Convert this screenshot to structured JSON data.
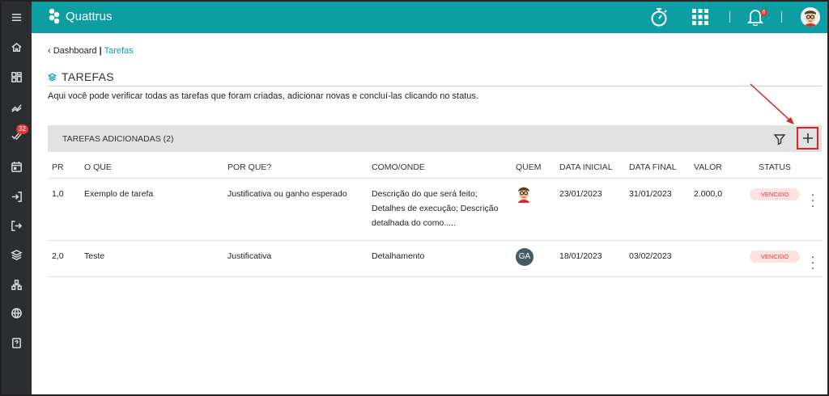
{
  "app": {
    "name": "Quattrus"
  },
  "colors": {
    "topbar": "#0d9ea3",
    "sidebar": "#2b2d31",
    "status_bg": "#fde2e2",
    "status_text": "#e53935",
    "highlight": "#e02020"
  },
  "sidebar": {
    "items": [
      {
        "icon": "menu-icon"
      },
      {
        "icon": "home-icon"
      },
      {
        "icon": "dashboard-icon"
      },
      {
        "icon": "chart-line-icon"
      },
      {
        "icon": "tasks-check-icon",
        "badge": "32"
      },
      {
        "icon": "calendar-icon"
      },
      {
        "icon": "login-icon"
      },
      {
        "icon": "logout-icon"
      },
      {
        "icon": "layers-icon"
      },
      {
        "icon": "sitemap-icon"
      },
      {
        "icon": "globe-icon"
      },
      {
        "icon": "help-icon"
      }
    ]
  },
  "topbar": {
    "bell_badge": "6"
  },
  "breadcrumb": {
    "parent": "Dashboard",
    "separator": "|",
    "current": "Tarefas"
  },
  "page": {
    "title": "TAREFAS",
    "description": "Aqui você pode verificar todas as tarefas que foram criadas, adicionar novas e concluí-las clicando no status."
  },
  "panel": {
    "title": "TAREFAS ADICIONADAS (2)"
  },
  "table": {
    "columns": [
      "PR",
      "O QUE",
      "POR QUE?",
      "COMO/ONDE",
      "QUEM",
      "DATA INICIAL",
      "DATA FINAL",
      "VALOR",
      "STATUS"
    ],
    "rows": [
      {
        "pr": "1,0",
        "what": "Exemplo de tarefa",
        "why": "Justificativa ou ganho esperado",
        "how": "Descrição do que será feito; Detalhes de execução; Descrição detalhada do como.....",
        "who": "avatar",
        "start": "23/01/2023",
        "end": "31/01/2023",
        "value": "2.000,0",
        "status": "VENCIDO"
      },
      {
        "pr": "2,0",
        "what": "Teste",
        "why": "Justificativa",
        "how": "Detalhamento",
        "who": "GA",
        "start": "18/01/2023",
        "end": "03/02/2023",
        "value": "",
        "status": "VENCIDO"
      }
    ]
  }
}
